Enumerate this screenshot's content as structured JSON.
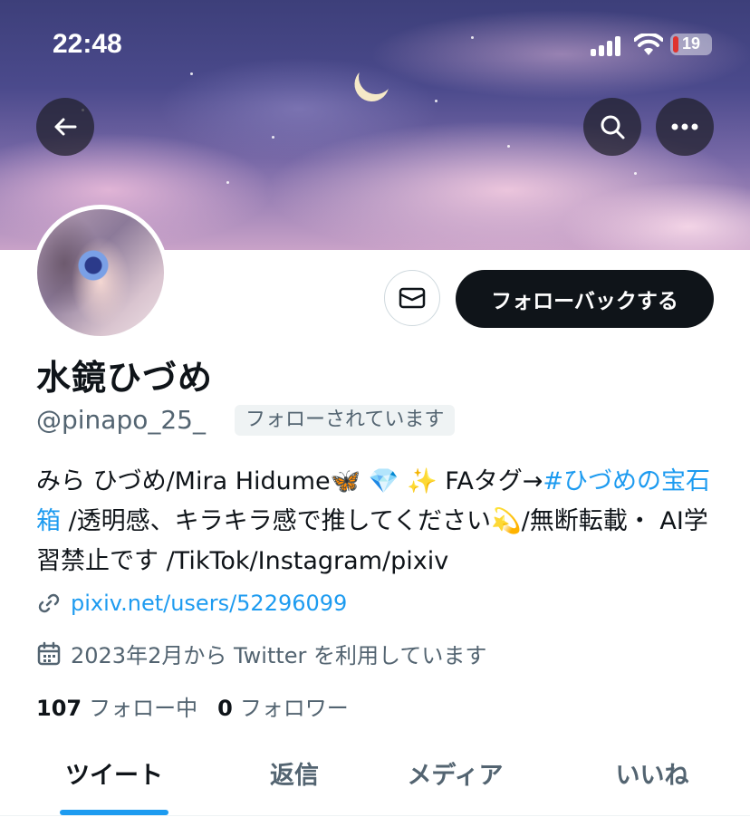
{
  "status_bar": {
    "time": "22:48",
    "battery": "19"
  },
  "profile": {
    "display_name": "水鏡ひづめ",
    "handle": "@pinapo_25_",
    "follows_you": "フォローされています",
    "bio": {
      "part1": "みら ひづめ/Mira Hidume🦋 💎 ✨  FAタグ→",
      "hashtag": "#ひづめの宝石箱",
      "part2": " /透明感、キラキラ感で推してください💫/無断転載・ AI学習禁止です /TikTok/Instagram/pixiv"
    },
    "link": "pixiv.net/users/52296099",
    "joined": "2023年2月から Twitter を利用しています",
    "following_count": "107",
    "following_label": "フォロー中",
    "followers_count": "0",
    "followers_label": "フォロワー"
  },
  "actions": {
    "follow_back": "フォローバックする"
  },
  "tabs": [
    "ツイート",
    "返信",
    "メディア",
    "いいね"
  ],
  "colors": {
    "accent": "#1d9bf0",
    "text": "#0f1419",
    "secondary_text": "#536471",
    "button_dark": "#0f1419"
  }
}
